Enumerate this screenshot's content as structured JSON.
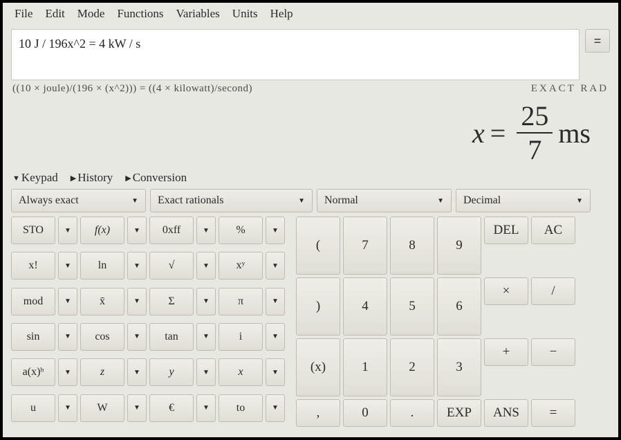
{
  "menubar": [
    "File",
    "Edit",
    "Mode",
    "Functions",
    "Variables",
    "Units",
    "Help"
  ],
  "input_value": "10 J / 196x^2 = 4 kW / s",
  "equals_btn": "=",
  "parsed_text": "((10 × joule)/(196 × (x^2))) = ((4 × kilowatt)/second)",
  "mode_indicator": "EXACT  RAD",
  "result": {
    "lhs_var": "x",
    "eq": "=",
    "num": "25",
    "den": "7",
    "unit": "ms"
  },
  "tabs": [
    {
      "label": "Keypad",
      "expanded": true
    },
    {
      "label": "History",
      "expanded": false
    },
    {
      "label": "Conversion",
      "expanded": false
    }
  ],
  "selectors": {
    "exactness": "Always exact",
    "fractions": "Exact rationals",
    "display": "Normal",
    "base": "Decimal"
  },
  "left_rows": [
    [
      "STO",
      "f(x)",
      "0xff",
      "%"
    ],
    [
      "x!",
      "ln",
      "√",
      "xʸ"
    ],
    [
      "mod",
      "x̄",
      "Σ",
      "π"
    ],
    [
      "sin",
      "cos",
      "tan",
      "i"
    ],
    [
      "a(x)ᵇ",
      "z",
      "y",
      "x"
    ],
    [
      "u",
      "W",
      "€",
      "to"
    ]
  ],
  "right_pad_labels": {
    "lparen": "(",
    "n7": "7",
    "n8": "8",
    "n9": "9",
    "del": "DEL",
    "ac": "AC",
    "rparen": ")",
    "n4": "4",
    "n5": "5",
    "n6": "6",
    "mul": "×",
    "div": "/",
    "xp": "(x)",
    "n1": "1",
    "n2": "2",
    "n3": "3",
    "plus": "+",
    "minus": "−",
    "comma": ",",
    "n0": "0",
    "dot": ".",
    "exp": "EXP",
    "ans": "ANS",
    "eq": "="
  }
}
